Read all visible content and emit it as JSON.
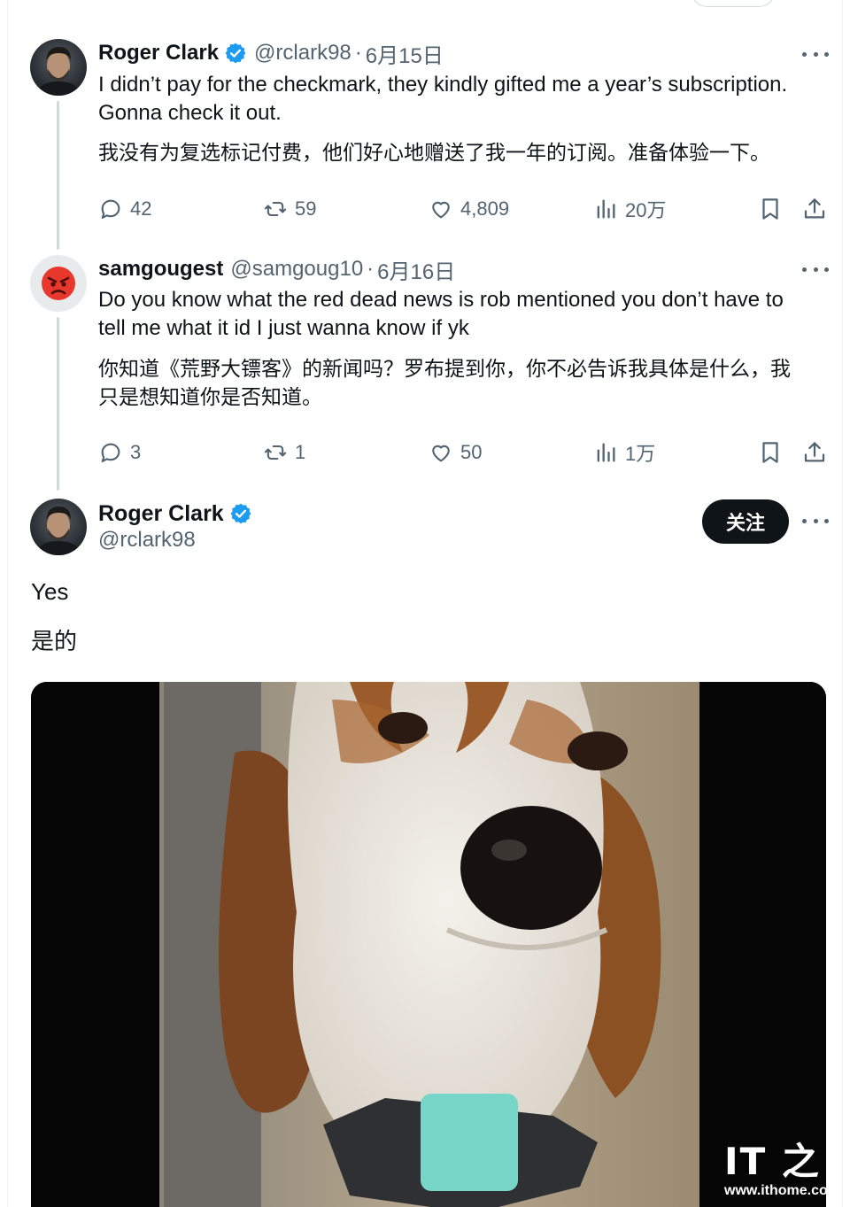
{
  "tweet1": {
    "name": "Roger Clark",
    "handle": "@rclark98",
    "separator": "·",
    "date": "6月15日",
    "text_en_line1": "I didn’t pay for the checkmark, they kindly gifted me a year’s subscription.",
    "text_en_line2": "Gonna check it out.",
    "text_zh": "我没有为复选标记付费，他们好心地赠送了我一年的订阅。准备体验一下。",
    "stats": {
      "replies": "42",
      "reposts": "59",
      "likes": "4,809",
      "views": "20万"
    }
  },
  "tweet2": {
    "name": "samgougest",
    "handle": "@samgoug10",
    "separator": "·",
    "date": "6月16日",
    "avatar_emoji": "😡",
    "text_en_line1": "Do you know what the red dead news is rob mentioned you don’t have to",
    "text_en_line2": "tell me what it id I just wanna know if yk",
    "text_zh_line1": "你知道《荒野大镖客》的新闻吗？罗布提到你，你不必告诉我具体是什么，我",
    "text_zh_line2": "只是想知道你是否知道。",
    "stats": {
      "replies": "3",
      "reposts": "1",
      "likes": "50",
      "views": "1万"
    }
  },
  "main": {
    "name": "Roger Clark",
    "handle": "@rclark98",
    "follow_label": "关注",
    "text_en": "Yes",
    "text_zh": "是的"
  },
  "watermark": {
    "logo": "IT 之",
    "url": "www.ithome.co"
  },
  "colors": {
    "verified": "#1d9bf0",
    "muted": "#536471",
    "text": "#0f1419",
    "thread_line": "#cfd9de",
    "follow_bg": "#0f1419"
  },
  "icons": [
    "reply-icon",
    "repost-icon",
    "like-icon",
    "views-icon",
    "bookmark-icon",
    "share-icon",
    "verified-badge-icon",
    "more-options-icon"
  ]
}
